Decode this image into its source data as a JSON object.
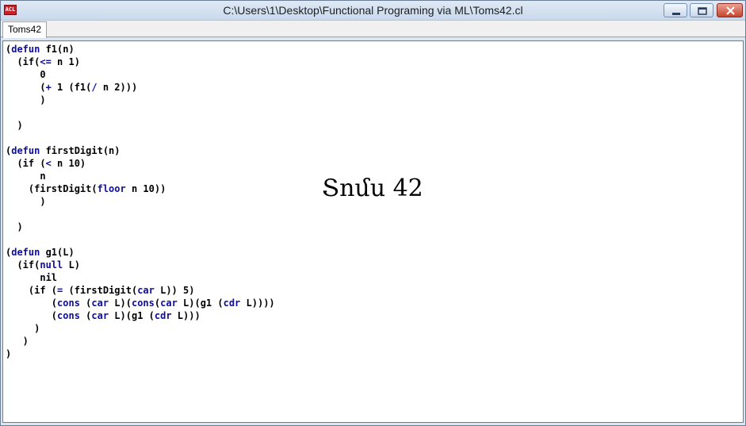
{
  "window": {
    "app_icon_text": "ACL",
    "title": "C:\\Users\\1\\Desktop\\Functional Programing via ML\\Toms42.cl",
    "controls": {
      "minimize": "minimize-icon",
      "maximize": "maximize-icon",
      "close": "close-icon"
    }
  },
  "tabs": [
    {
      "label": "Toms42"
    }
  ],
  "editor": {
    "lines": [
      [
        {
          "t": "("
        },
        {
          "t": "defun",
          "k": 1
        },
        {
          "t": " f1(n)"
        }
      ],
      [
        {
          "t": "  (if("
        },
        {
          "t": "<=",
          "k": 1
        },
        {
          "t": " n 1)"
        }
      ],
      [
        {
          "t": "      0"
        }
      ],
      [
        {
          "t": "      ("
        },
        {
          "t": "+",
          "k": 1
        },
        {
          "t": " 1 (f1("
        },
        {
          "t": "/",
          "k": 1
        },
        {
          "t": " n 2)))"
        }
      ],
      [
        {
          "t": "      )"
        }
      ],
      [
        {
          "t": ""
        }
      ],
      [
        {
          "t": "  )"
        }
      ],
      [
        {
          "t": ""
        }
      ],
      [
        {
          "t": "("
        },
        {
          "t": "defun",
          "k": 1
        },
        {
          "t": " firstDigit(n)"
        }
      ],
      [
        {
          "t": "  (if ("
        },
        {
          "t": "<",
          "k": 1
        },
        {
          "t": " n 10)"
        }
      ],
      [
        {
          "t": "      n"
        }
      ],
      [
        {
          "t": "    (firstDigit("
        },
        {
          "t": "floor",
          "k": 1
        },
        {
          "t": " n 10))"
        }
      ],
      [
        {
          "t": "      )"
        }
      ],
      [
        {
          "t": ""
        }
      ],
      [
        {
          "t": "  )"
        }
      ],
      [
        {
          "t": ""
        }
      ],
      [
        {
          "t": "("
        },
        {
          "t": "defun",
          "k": 1
        },
        {
          "t": " g1(L)"
        }
      ],
      [
        {
          "t": "  (if("
        },
        {
          "t": "null",
          "k": 1
        },
        {
          "t": " L)"
        }
      ],
      [
        {
          "t": "      nil"
        }
      ],
      [
        {
          "t": "    (if ("
        },
        {
          "t": "=",
          "k": 1
        },
        {
          "t": " (firstDigit("
        },
        {
          "t": "car",
          "k": 1
        },
        {
          "t": " L)) 5)"
        }
      ],
      [
        {
          "t": "        ("
        },
        {
          "t": "cons",
          "k": 1
        },
        {
          "t": " ("
        },
        {
          "t": "car",
          "k": 1
        },
        {
          "t": " L)("
        },
        {
          "t": "cons",
          "k": 1
        },
        {
          "t": "("
        },
        {
          "t": "car",
          "k": 1
        },
        {
          "t": " L)(g1 ("
        },
        {
          "t": "cdr",
          "k": 1
        },
        {
          "t": " L))))"
        }
      ],
      [
        {
          "t": "        ("
        },
        {
          "t": "cons",
          "k": 1
        },
        {
          "t": " ("
        },
        {
          "t": "car",
          "k": 1
        },
        {
          "t": " L)(g1 ("
        },
        {
          "t": "cdr",
          "k": 1
        },
        {
          "t": " L)))"
        }
      ],
      [
        {
          "t": "     )"
        }
      ],
      [
        {
          "t": "   )"
        }
      ],
      [
        {
          "t": ")"
        }
      ]
    ],
    "overlay_text": "Տոմս 42"
  },
  "colors": {
    "keyword": "#0d0d9e",
    "text": "#000000",
    "editor_background": "#ffffff",
    "title_bar": "#dfe9f5"
  }
}
